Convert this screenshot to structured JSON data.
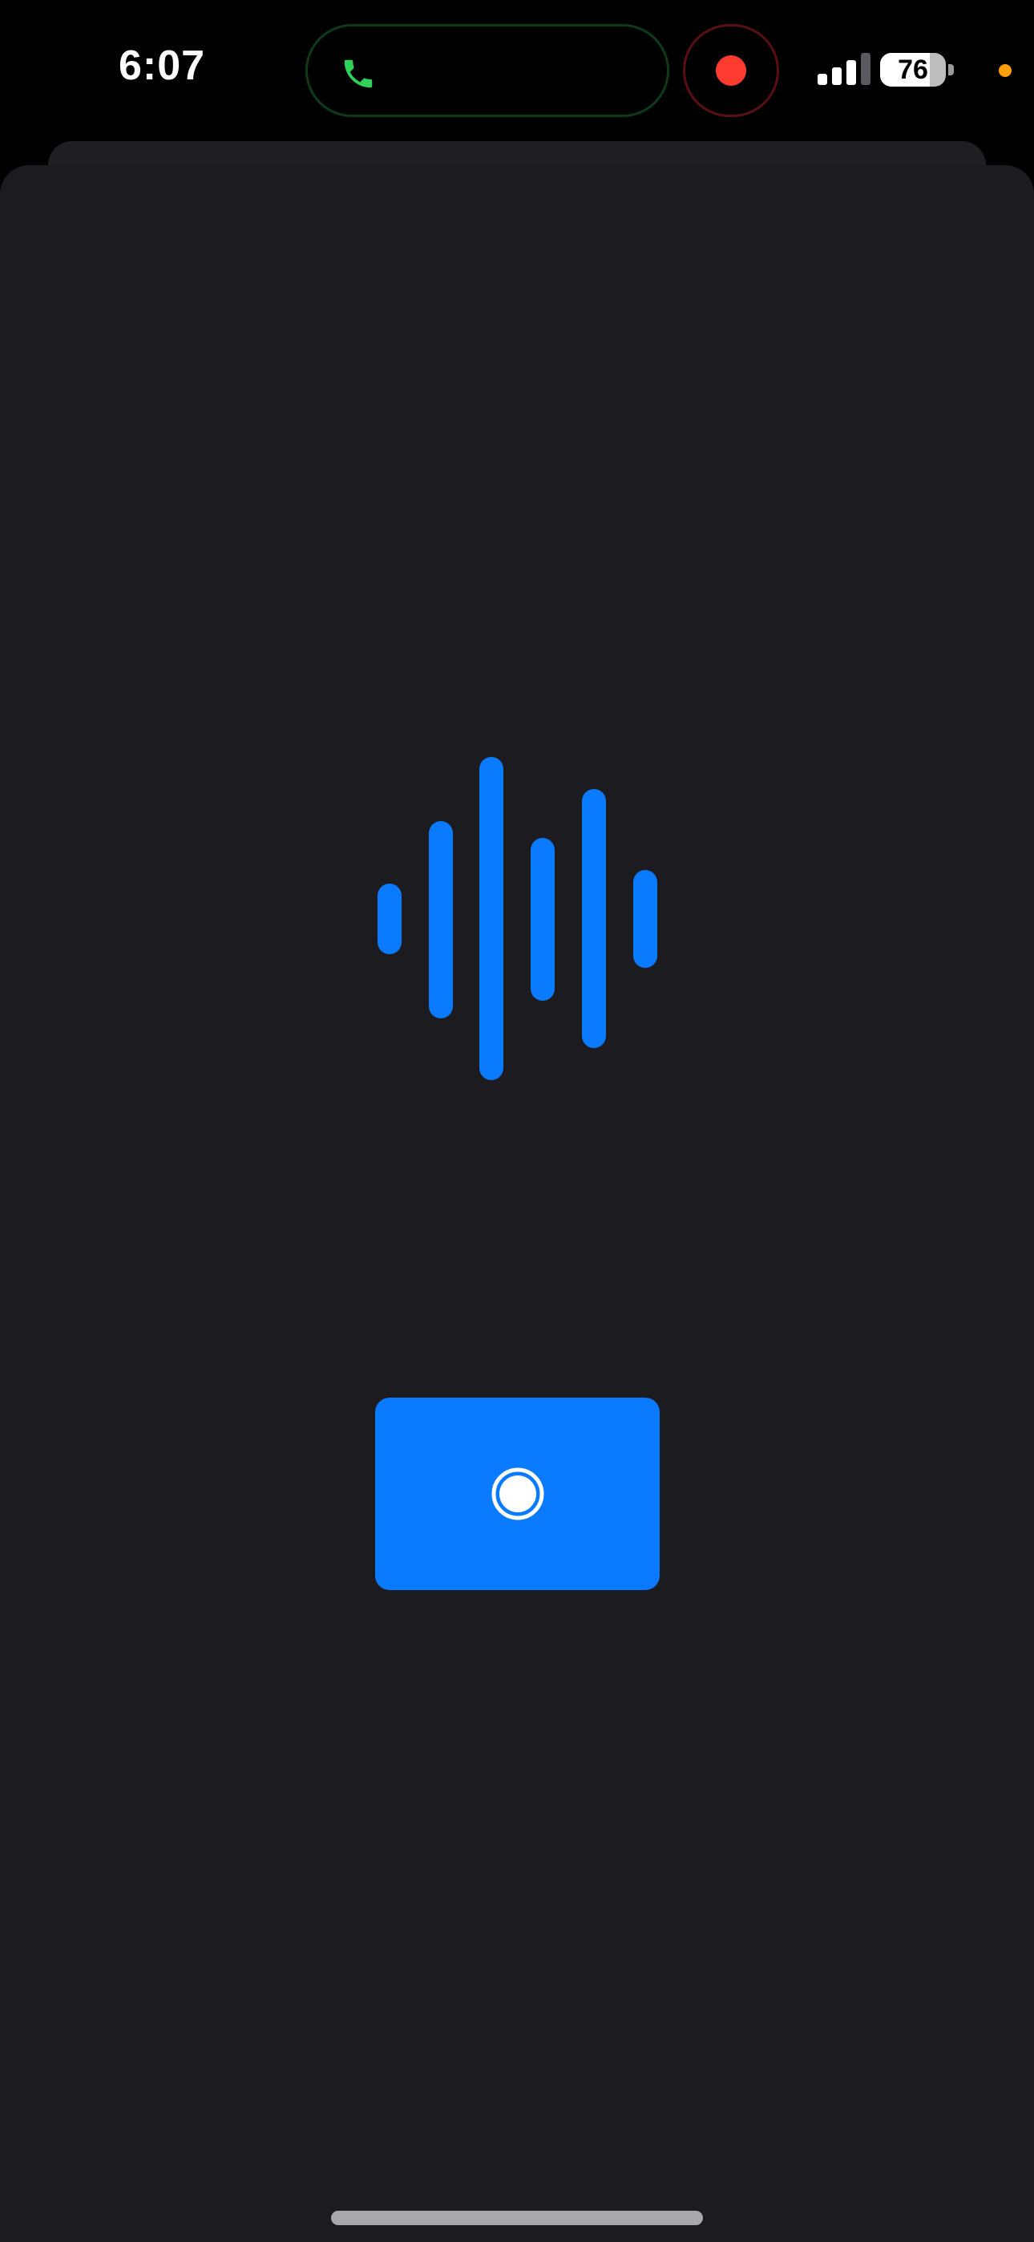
{
  "status_bar": {
    "time": "6:07",
    "call_icon": "phone-icon",
    "recording_icon": "record-dot-icon",
    "signal_icon": "cellular-signal-icon",
    "battery_level": "76",
    "battery_fraction": 0.76,
    "privacy_indicator_color": "#ff9f0a"
  },
  "main": {
    "waveform_icon": "audio-waveform-icon",
    "waveform_color": "#0a7aff",
    "record_button_icon": "record-icon",
    "record_button_color": "#0a7aff"
  },
  "colors": {
    "background": "#1c1b20",
    "accent": "#0a7aff",
    "call_green": "#30d158",
    "recording_red": "#ff3b30"
  }
}
